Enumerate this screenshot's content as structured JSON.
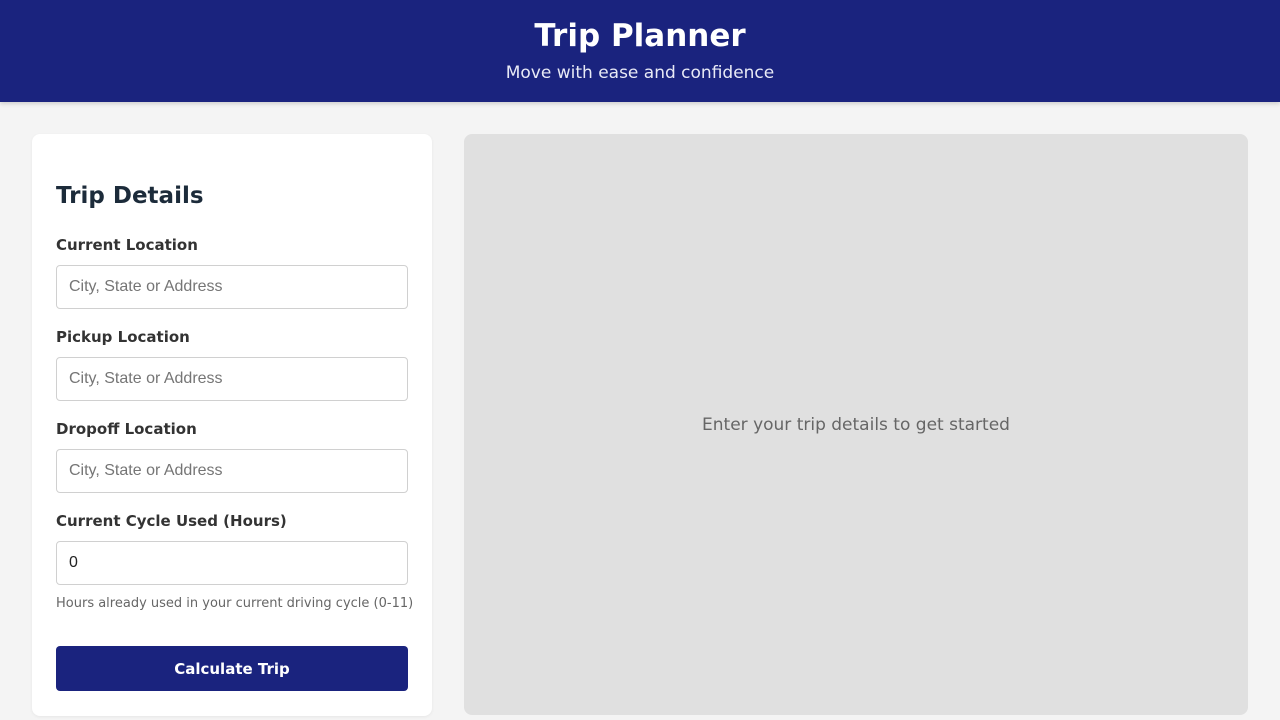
{
  "header": {
    "title": "Trip Planner",
    "subtitle": "Move with ease and confidence"
  },
  "form": {
    "title": "Trip Details",
    "fields": [
      {
        "label": "Current Location",
        "value": "",
        "placeholder": "City, State or Address"
      },
      {
        "label": "Pickup Location",
        "value": "",
        "placeholder": "City, State or Address"
      },
      {
        "label": "Dropoff Location",
        "value": "",
        "placeholder": "City, State or Address"
      },
      {
        "label": "Current Cycle Used (Hours)",
        "value": "0",
        "placeholder": ""
      }
    ],
    "helper": "Hours already used in your current driving cycle (0-11)",
    "submit_label": "Calculate Trip"
  },
  "map": {
    "placeholder": "Enter your trip details to get started"
  },
  "colors": {
    "brand": "#1a237e",
    "background": "#f4f4f4",
    "map_background": "#e0e0e0"
  }
}
